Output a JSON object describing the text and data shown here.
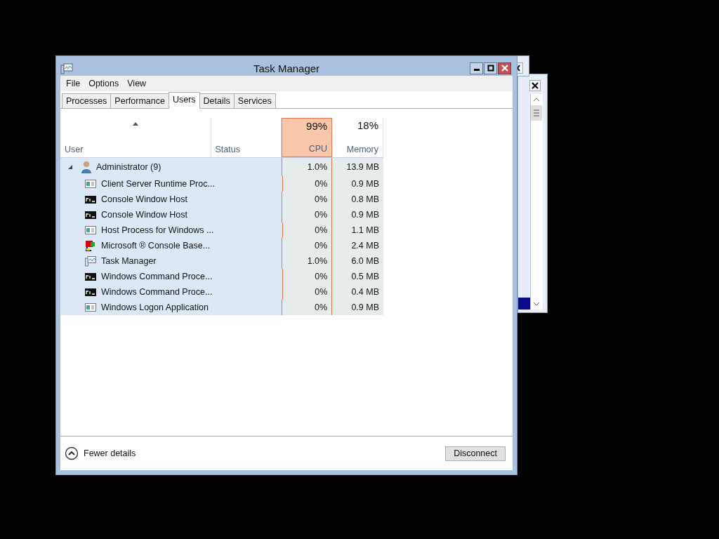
{
  "window": {
    "title": "Task Manager"
  },
  "menu": [
    "File",
    "Options",
    "View"
  ],
  "tabs": [
    {
      "label": "Processes",
      "selected": false
    },
    {
      "label": "Performance",
      "selected": false
    },
    {
      "label": "Users",
      "selected": true
    },
    {
      "label": "Details",
      "selected": false
    },
    {
      "label": "Services",
      "selected": false
    }
  ],
  "columns": [
    {
      "kind": "user",
      "label": "User",
      "sorted": true
    },
    {
      "kind": "status",
      "label": "Status",
      "sorted": false
    },
    {
      "kind": "cpu",
      "total": "99%",
      "label": "CPU",
      "sorted": false,
      "highlighted": true
    },
    {
      "kind": "memory",
      "total": "18%",
      "label": "Memory",
      "sorted": false,
      "highlighted": false
    }
  ],
  "users": [
    {
      "name": "Administrator (9)",
      "expanded": true,
      "selected": true,
      "cpu": "1.0%",
      "memory": "13.9 MB",
      "processes": [
        {
          "kind": "window",
          "name": "Client Server Runtime Proc...",
          "cpu": "0%",
          "memory": "0.9 MB"
        },
        {
          "kind": "console",
          "name": "Console Window Host",
          "cpu": "0%",
          "memory": "0.8 MB"
        },
        {
          "kind": "console",
          "name": "Console Window Host",
          "cpu": "0%",
          "memory": "0.9 MB"
        },
        {
          "kind": "window",
          "name": "Host Process for Windows ...",
          "cpu": "0%",
          "memory": "1.1 MB"
        },
        {
          "kind": "mmc",
          "name": "Microsoft ® Console Base...",
          "cpu": "0%",
          "memory": "2.4 MB"
        },
        {
          "kind": "taskmgr",
          "name": "Task Manager",
          "cpu": "1.0%",
          "memory": "6.0 MB"
        },
        {
          "kind": "console",
          "name": "Windows Command Proce...",
          "cpu": "0%",
          "memory": "0.5 MB"
        },
        {
          "kind": "console",
          "name": "Windows Command Proce...",
          "cpu": "0%",
          "memory": "0.4 MB"
        },
        {
          "kind": "window",
          "name": "Windows Logon Application",
          "cpu": "0%",
          "memory": "0.9 MB"
        }
      ]
    }
  ],
  "footer": {
    "toggle": "Fewer details",
    "button": "Disconnect"
  }
}
